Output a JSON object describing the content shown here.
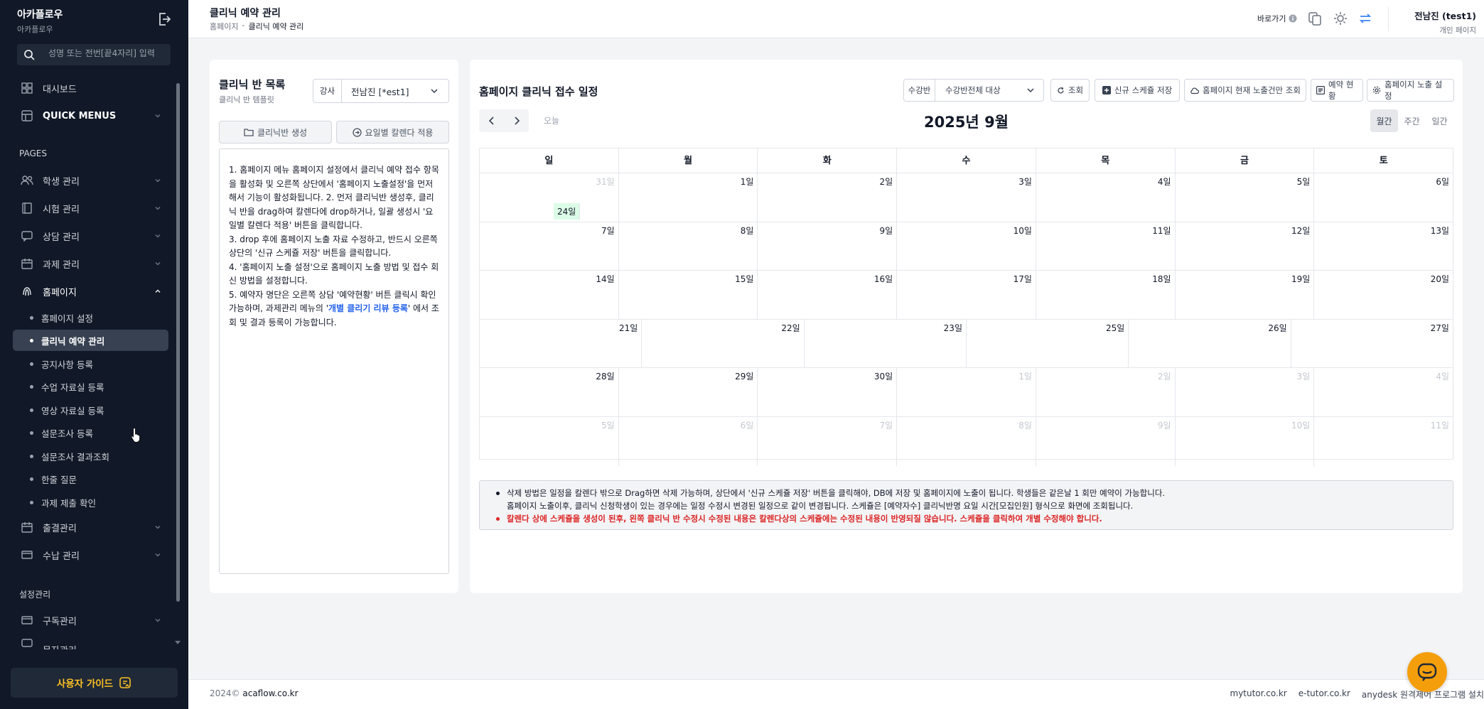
{
  "sidebar": {
    "brand_title": "아카플로우",
    "brand_sub": "아카플로우",
    "search_placeholder": "성명 또는 전번[끝4자리] 입력",
    "dashboard": "대시보드",
    "quick_menus": "QUICK MENUS",
    "section_pages": "PAGES",
    "menus": [
      {
        "label": "학생 관리",
        "icon": "users-icon"
      },
      {
        "label": "시험 관리",
        "icon": "book-icon"
      },
      {
        "label": "상담 관리",
        "icon": "chat-icon"
      },
      {
        "label": "과제 관리",
        "icon": "calendar-icon"
      },
      {
        "label": "홈페이지",
        "icon": "fingerprint-icon"
      }
    ],
    "homepage_sub": [
      "홈페이지 설정",
      "클리닉 예약 관리",
      "공지사항 등록",
      "수업 자료실 등록",
      "영상 자료실 등록",
      "설문조사 등록",
      "설문조사 결과조회",
      "한줄 질문",
      "과제 제출 확인"
    ],
    "menus2": [
      {
        "label": "출결관리",
        "icon": "calendar-icon"
      },
      {
        "label": "수납 관리",
        "icon": "card-icon"
      }
    ],
    "section_settings": "설정관리",
    "settings_menus": [
      {
        "label": "구독관리",
        "icon": "card-icon"
      },
      {
        "label": "문자관리",
        "icon": "message-icon"
      }
    ],
    "guide_button": "사용자 가이드"
  },
  "header": {
    "title": "클리닉 예약 관리",
    "breadcrumb_home": "홈페이지",
    "breadcrumb_current": "클리닉 예약 관리",
    "quick_label": "바로가기",
    "user_name": "전남진 (test1)",
    "user_sub": "개인 페이지"
  },
  "left_panel": {
    "title": "클리닉 반 목록",
    "subtitle": "클리닉 반 템플릿",
    "teacher_label": "강사",
    "teacher_value": "전남진 [*est1]",
    "create_btn": "클리닉반 생성",
    "apply_btn": "요일별 칼렌다 적용",
    "guide_1": "1. 홈페이지 메뉴 홈페이지 설정에서 클리닉 예약 접수 항목을 활성화 및 오른쪽 상단에서 '홈페이지 노출설정'을 먼저해서 기능이 활성화됩니다. 2. 먼저 클리닉반 생성후, 클리닉 반을 drag하여 칼렌다에 drop하거나, 일괄 생성시 '요일별 칼렌다 적용' 버튼을 클릭합니다.",
    "guide_3": "3. drop 후에 홈페이지 노출 자료 수정하고, 반드시 오른쪽 상단의 '신규 스케쥴 저장' 버튼을 클릭합니다.",
    "guide_4": "4. '홈페이지 노출 설정'으로 홈페이지 노출 방법 및 접수 회신 방법을 설정합니다.",
    "guide_5a": "5. 예약자 명단은 오른쪽 상담 '예약현황' 버튼 클릭시 확인가능하며, 과제관리 메뉴의 '",
    "guide_5link": "개별 클리기 리뷰 등록",
    "guide_5b": "' 에서 조회 및 결과 등록이 가능합니다."
  },
  "main_panel": {
    "title": "홈페이지 클리닉 접수 일정",
    "course_label": "수강반",
    "course_value": "수강반전체 대상",
    "buttons": {
      "refresh": "조회",
      "save": "신규 스케쥴 저장",
      "view_current": "홈페이지 현재 노출건만 조회",
      "reservations": "예약 현황",
      "exposure": "홈페이지 노출 설정"
    },
    "today": "오늘",
    "month_title": "2025년 9월",
    "views": [
      "월간",
      "주간",
      "일간"
    ],
    "weekdays": [
      "일",
      "월",
      "화",
      "수",
      "목",
      "금",
      "토"
    ],
    "weeks": [
      [
        {
          "d": "31일",
          "o": true
        },
        {
          "d": "1일"
        },
        {
          "d": "2일"
        },
        {
          "d": "3일"
        },
        {
          "d": "4일"
        },
        {
          "d": "5일"
        },
        {
          "d": "6일"
        }
      ],
      [
        {
          "d": "7일"
        },
        {
          "d": "8일"
        },
        {
          "d": "9일"
        },
        {
          "d": "10일"
        },
        {
          "d": "11일"
        },
        {
          "d": "12일"
        },
        {
          "d": "13일"
        }
      ],
      [
        {
          "d": "14일"
        },
        {
          "d": "15일"
        },
        {
          "d": "16일"
        },
        {
          "d": "17일"
        },
        {
          "d": "18일"
        },
        {
          "d": "19일"
        },
        {
          "d": "20일"
        }
      ],
      [
        {
          "d": "21일"
        },
        {
          "d": "22일"
        },
        {
          "d": "23일"
        },
        {
          "d": "24일",
          "t": true
        },
        {
          "d": "25일"
        },
        {
          "d": "26일"
        },
        {
          "d": "27일"
        }
      ],
      [
        {
          "d": "28일"
        },
        {
          "d": "29일"
        },
        {
          "d": "30일"
        },
        {
          "d": "1일",
          "o": true
        },
        {
          "d": "2일",
          "o": true
        },
        {
          "d": "3일",
          "o": true
        },
        {
          "d": "4일",
          "o": true
        }
      ],
      [
        {
          "d": "5일",
          "o": true
        },
        {
          "d": "6일",
          "o": true
        },
        {
          "d": "7일",
          "o": true
        },
        {
          "d": "8일",
          "o": true
        },
        {
          "d": "9일",
          "o": true
        },
        {
          "d": "10일",
          "o": true
        },
        {
          "d": "11일",
          "o": true
        }
      ]
    ],
    "note_1": "삭제 방법은 일정을 칼렌다 밖으로 Drag하면 삭제 가능하며, 상단에서 '신규 스케쥴 저장' 버튼을 클릭해야, DB에 저장 및 홈페이지에 노출이 됩니다. 학생들은 같은날 1 회만 예약이 가능합니다.",
    "note_1b": "홈페이지 노출이후, 클리닉 신청학생이 있는 경우에는 일정 수정시 변경된 일정으로 같이 변경됩니다. 스케쥴은 [예약자수] 클리닉반명 요일 시간[모집인원] 형식으로 화면에 조회됩니다.",
    "note_2": "칼렌다 상에 스케쥴을 생성이 된후, 왼쪽 클리닉 반 수정시 수정된 내용은 칼렌다상의 스케쥴에는 수정된 내용이 반영되질 않습니다. 스케쥴을 클릭하여 개별 수정해야 합니다."
  },
  "footer": {
    "year": "2024©",
    "domain": "acaflow.co.kr",
    "links": [
      "mytutor.co.kr",
      "e-tutor.co.kr",
      "anydesk 원격제어 프로그램 설치"
    ]
  },
  "colors": {
    "sidebar_bg": "#111827",
    "accent_blue": "#2563eb",
    "today_bg": "#dcfce7",
    "warning_red": "#dc2626",
    "chat_orange": "#f59e0b"
  }
}
